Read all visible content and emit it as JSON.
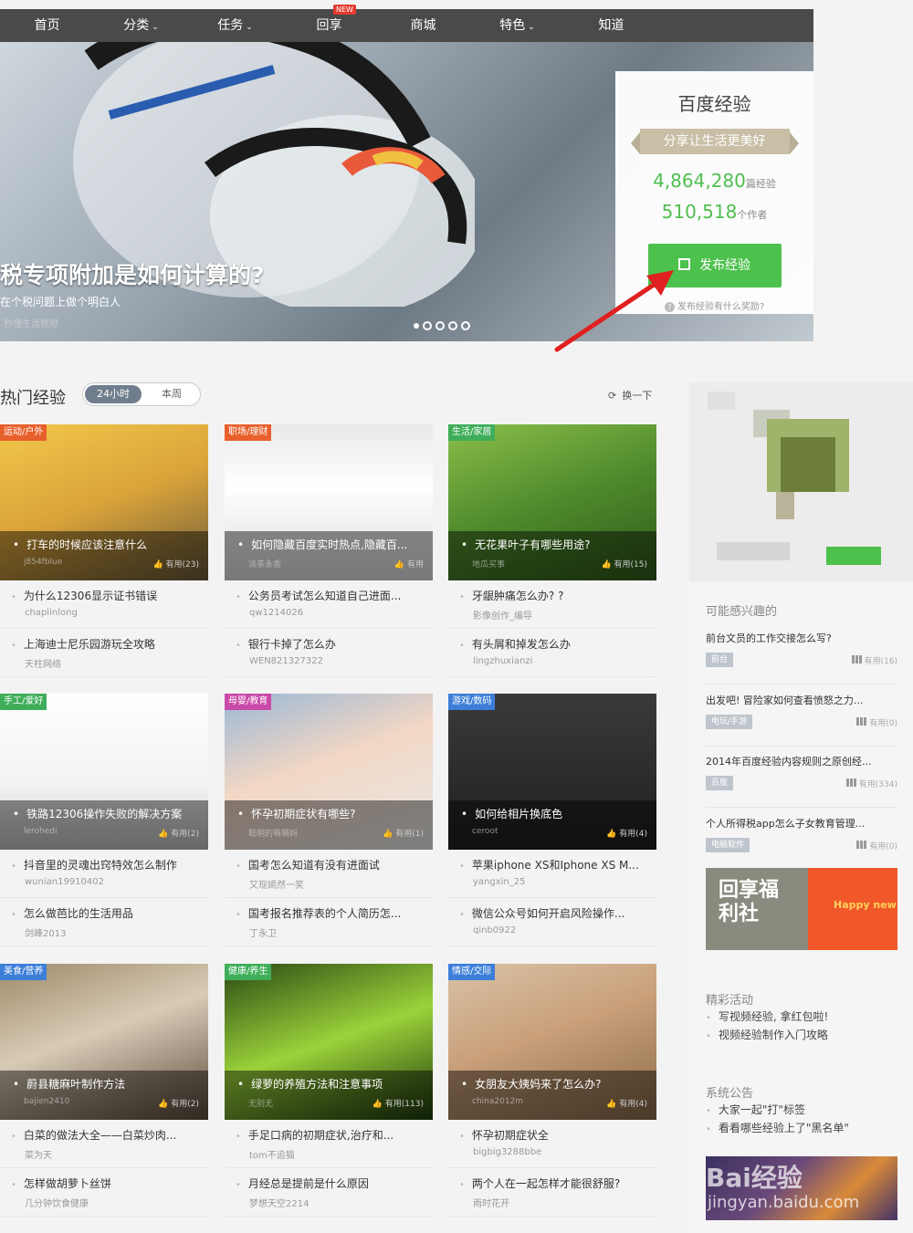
{
  "nav": {
    "items": [
      {
        "label": "首页",
        "chevron": false
      },
      {
        "label": "分类",
        "chevron": true
      },
      {
        "label": "任务",
        "chevron": true
      },
      {
        "label": "回享",
        "chevron": false
      },
      {
        "label": "商城",
        "chevron": false
      },
      {
        "label": "特色",
        "chevron": true
      },
      {
        "label": "知道",
        "chevron": false
      }
    ],
    "new_badge": "NEW"
  },
  "banner": {
    "headline": "税专项附加是如何计算的?",
    "subtitle": "在个税问题上做个明白人",
    "source": "秒懂生活视频"
  },
  "stats": {
    "title": "百度经验",
    "slogan": "分享让生活更美好",
    "count1": "4,864,280",
    "count1_unit": "篇经验",
    "count2": "510,518",
    "count2_unit": "个作者",
    "publish_label": "发布经验",
    "reward_text": "发布经验有什么奖励?"
  },
  "hot": {
    "title": "热门经验",
    "tab_24h": "24小时",
    "tab_week": "本周",
    "refresh": "换一下"
  },
  "cards": [
    {
      "cat": "运动/户外",
      "cat_color": "#e8612c",
      "title": "打车的时候应该注意什么",
      "author": "j854fblue",
      "useful": "有用(23)",
      "rows": [
        {
          "t": "为什么12306显示证书错误",
          "a": "chaplinlong"
        },
        {
          "t": "上海迪士尼乐园游玩全攻略",
          "a": "天柱网络"
        }
      ]
    },
    {
      "cat": "职场/理财",
      "cat_color": "#e8612c",
      "title": "如何隐藏百度实时热点,隐藏百...",
      "author": "淡茶永香",
      "useful": "有用",
      "rows": [
        {
          "t": "公务员考试怎么知道自己进面...",
          "a": "qw1214026"
        },
        {
          "t": "银行卡掉了怎么办",
          "a": "WEN821327322"
        }
      ]
    },
    {
      "cat": "生活/家居",
      "cat_color": "#3fae5a",
      "title": "无花果叶子有哪些用途?",
      "author": "地瓜买事",
      "useful": "有用(15)",
      "rows": [
        {
          "t": "牙龈肿痛怎么办? ?",
          "a": "影像创作_编导"
        },
        {
          "t": "有头屑和掉发怎么办",
          "a": "lingzhuxianzi"
        }
      ]
    },
    {
      "cat": "手工/爱好",
      "cat_color": "#3fae5a",
      "title": "铁路12306操作失败的解决方案",
      "author": "lerohedi",
      "useful": "有用(2)",
      "rows": [
        {
          "t": "抖音里的灵魂出窍特效怎么制作",
          "a": "wunian19910402"
        },
        {
          "t": "怎么做芭比的生活用品",
          "a": "剑峰2013"
        }
      ]
    },
    {
      "cat": "母婴/教育",
      "cat_color": "#c94aa8",
      "title": "怀孕初期症状有哪些?",
      "author": "聪明的萌萌妈",
      "useful": "有用(1)",
      "rows": [
        {
          "t": "国考怎么知道有没有进面试",
          "a": "又现嫣然一笑"
        },
        {
          "t": "国考报名推荐表的个人简历怎...",
          "a": "丁永卫"
        }
      ]
    },
    {
      "cat": "游戏/数码",
      "cat_color": "#3d7fd8",
      "title": "如何给相片换底色",
      "author": "ceroot",
      "useful": "有用(4)",
      "rows": [
        {
          "t": "苹果iphone XS和Iphone XS M...",
          "a": "yangxin_25"
        },
        {
          "t": "微信公众号如何开启风险操作...",
          "a": "qinb0922"
        }
      ]
    },
    {
      "cat": "美食/营养",
      "cat_color": "#3d7fd8",
      "title": "蔚县糖麻叶制作方法",
      "author": "bajien2410",
      "useful": "有用(2)",
      "rows": [
        {
          "t": "白菜的做法大全——白菜炒肉...",
          "a": "菜为天"
        },
        {
          "t": "怎样做胡萝卜丝饼",
          "a": "几分钟饮食健康"
        }
      ]
    },
    {
      "cat": "健康/养生",
      "cat_color": "#3fae5a",
      "title": "绿萝的养殖方法和注意事项",
      "author": "无别无",
      "useful": "有用(113)",
      "rows": [
        {
          "t": "手足口病的初期症状,治疗和...",
          "a": "tom不追猫"
        },
        {
          "t": "月经总是提前是什么原因",
          "a": "梦想天空2214"
        }
      ]
    },
    {
      "cat": "情感/交际",
      "cat_color": "#3d7fd8",
      "title": "女朋友大姨妈来了怎么办?",
      "author": "china2012m",
      "useful": "有用(4)",
      "rows": [
        {
          "t": "怀孕初期症状全",
          "a": "bigbig3288bbe"
        },
        {
          "t": "两个人在一起怎样才能很舒服?",
          "a": "雨时花开"
        }
      ]
    }
  ],
  "sidebar": {
    "interest_title": "可能感兴趣的",
    "interests": [
      {
        "t": "前台文员的工作交接怎么写?",
        "tag": "前台",
        "u": "有用(16)"
      },
      {
        "t": "出发吧! 冒险家如何查看愤怒之力...",
        "tag": "电玩/手游",
        "u": "有用(0)"
      },
      {
        "t": "2014年百度经验内容规则之原创经...",
        "tag": "百度",
        "u": "有用(334)"
      },
      {
        "t": "个人所得税app怎么子女教育管理...",
        "tag": "电脑软件",
        "u": "有用(0)"
      }
    ],
    "promo_text": "回享福利社",
    "promo_sub": "Happy new",
    "activity_title": "精彩活动",
    "activities": [
      "写视频经验, 拿红包啦!",
      "视频经验制作入门攻略"
    ],
    "notice_title": "系统公告",
    "notices": [
      "大家一起\"打\"标签",
      "看看哪些经验上了\"黑名单\""
    ],
    "watermark1": "Bai经验",
    "watermark2": "jingyan.baidu.com"
  }
}
